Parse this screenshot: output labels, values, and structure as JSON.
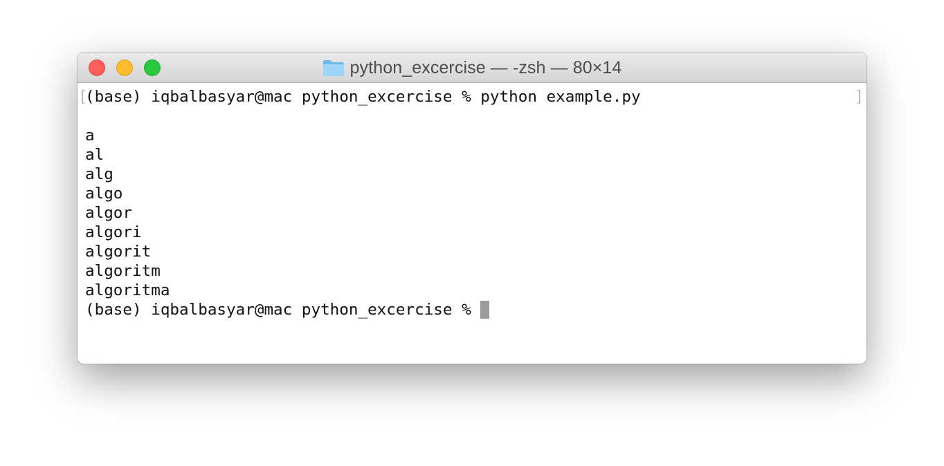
{
  "window": {
    "title": "python_excercise — -zsh — 80×14",
    "folder_icon": "folder-icon",
    "colors": {
      "close": "#fc5f57",
      "minimize": "#fdbc2e",
      "zoom": "#28c840",
      "cursor": "#9b9b9b",
      "text": "#111111"
    }
  },
  "terminal": {
    "mark_left": "[",
    "mark_right": "]",
    "lines": [
      "(base) iqbalbasyar@mac python_excercise % python example.py",
      "",
      "a",
      "al",
      "alg",
      "algo",
      "algor",
      "algori",
      "algorit",
      "algoritm",
      "algoritma",
      "(base) iqbalbasyar@mac python_excercise % "
    ]
  }
}
